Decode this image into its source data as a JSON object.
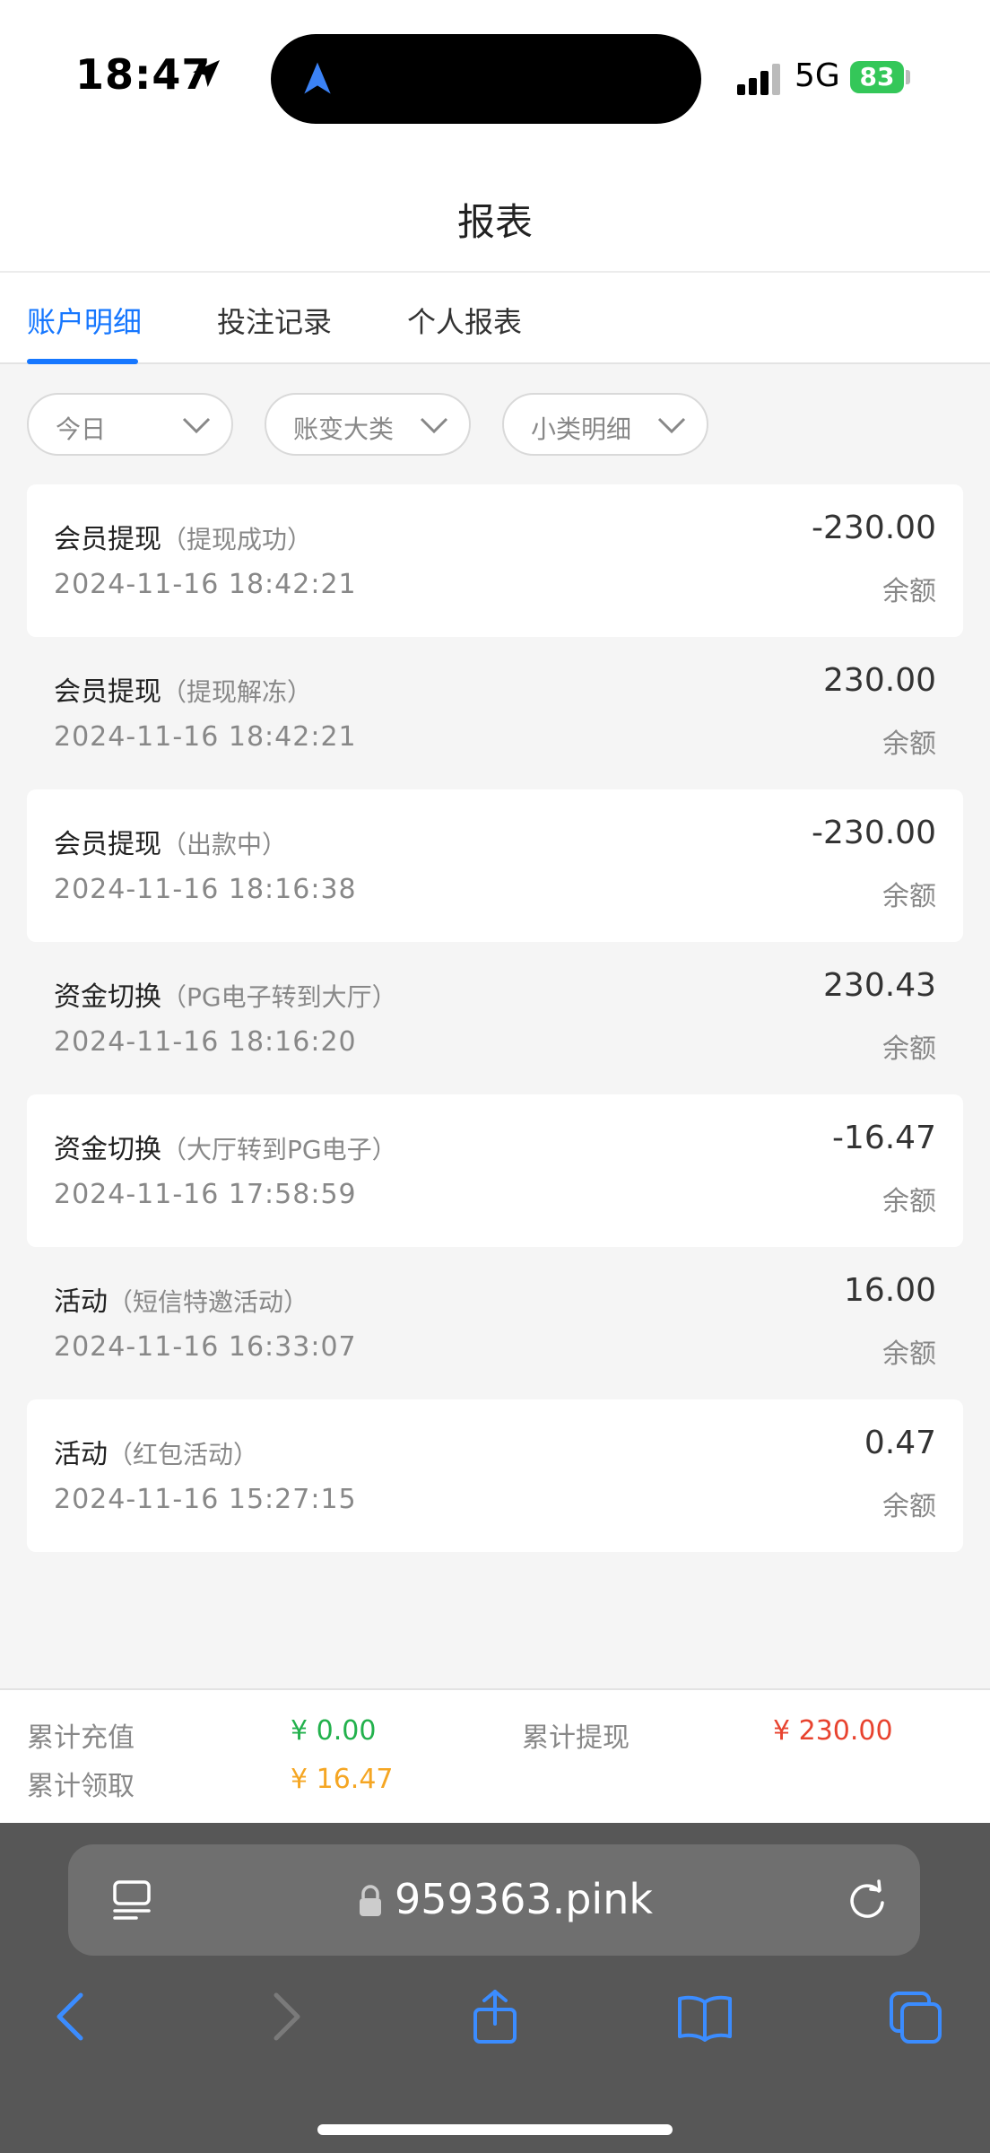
{
  "status_bar": {
    "time": "18:47",
    "network": "5G",
    "battery": "83"
  },
  "header": {
    "title": "报表"
  },
  "tabs": [
    {
      "label": "账户明细",
      "active": true
    },
    {
      "label": "投注记录",
      "active": false
    },
    {
      "label": "个人报表",
      "active": false
    }
  ],
  "filters": [
    {
      "label": "今日"
    },
    {
      "label": "账变大类"
    },
    {
      "label": "小类明细"
    }
  ],
  "records": [
    {
      "type": "会员提现",
      "sub": "（提现成功）",
      "time": "2024-11-16 18:42:21",
      "amount": "-230.00",
      "balance_label": "余额"
    },
    {
      "type": "会员提现",
      "sub": "（提现解冻）",
      "time": "2024-11-16 18:42:21",
      "amount": "230.00",
      "balance_label": "余额"
    },
    {
      "type": "会员提现",
      "sub": "（出款中）",
      "time": "2024-11-16 18:16:38",
      "amount": "-230.00",
      "balance_label": "余额"
    },
    {
      "type": "资金切换",
      "sub": "（PG电子转到大厅）",
      "time": "2024-11-16 18:16:20",
      "amount": "230.43",
      "balance_label": "余额"
    },
    {
      "type": "资金切换",
      "sub": "（大厅转到PG电子）",
      "time": "2024-11-16 17:58:59",
      "amount": "-16.47",
      "balance_label": "余额"
    },
    {
      "type": "活动",
      "sub": "（短信特邀活动）",
      "time": "2024-11-16 16:33:07",
      "amount": "16.00",
      "balance_label": "余额"
    },
    {
      "type": "活动",
      "sub": "（红包活动）",
      "time": "2024-11-16 15:27:15",
      "amount": "0.47",
      "balance_label": "余额"
    }
  ],
  "summary": {
    "recharge_label": "累计充值",
    "recharge_value": "¥ 0.00",
    "withdraw_label": "累计提现",
    "withdraw_value": "¥ 230.00",
    "claim_label": "累计领取",
    "claim_value": "¥ 16.47"
  },
  "browser": {
    "url": "959363.pink"
  },
  "colors": {
    "accent": "#1677ff",
    "recharge": "#22b14c",
    "withdraw": "#e8432f",
    "claim": "#f5a623",
    "battery": "#34c759"
  }
}
